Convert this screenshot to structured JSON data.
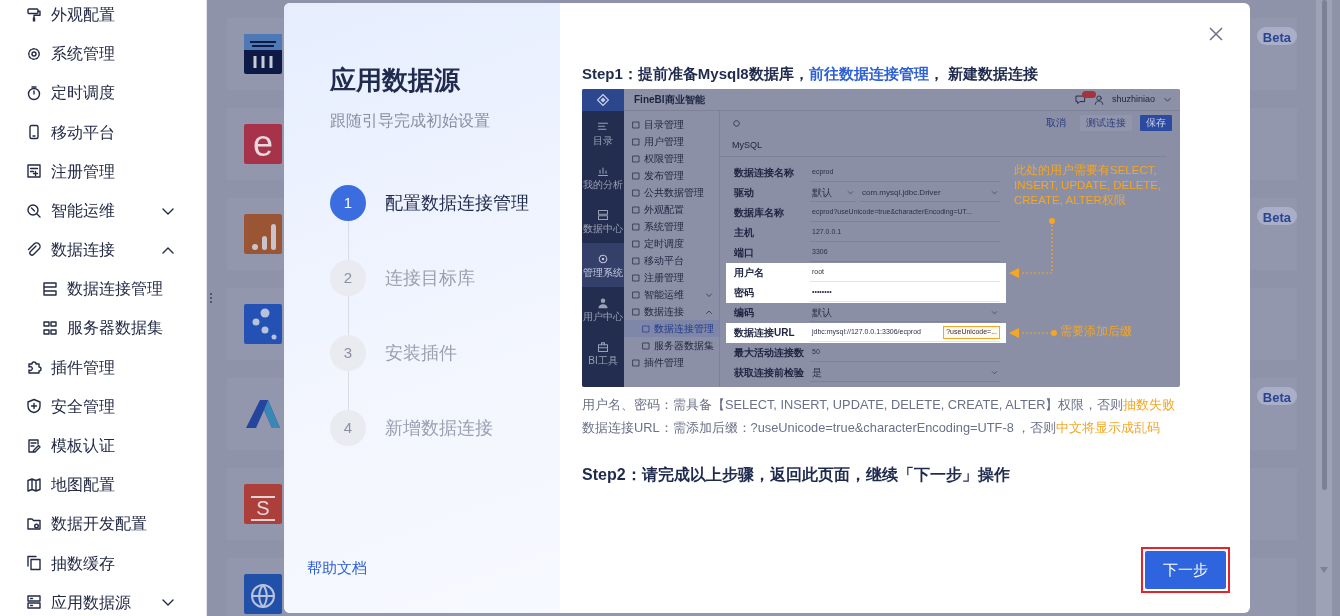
{
  "sidebar": {
    "items": [
      {
        "label": "外观配置"
      },
      {
        "label": "系统管理"
      },
      {
        "label": "定时调度"
      },
      {
        "label": "移动平台"
      },
      {
        "label": "注册管理"
      },
      {
        "label": "智能运维",
        "expanded": false
      },
      {
        "label": "数据连接",
        "expanded": true,
        "children": [
          {
            "label": "数据连接管理"
          },
          {
            "label": "服务器数据集"
          }
        ]
      },
      {
        "label": "插件管理"
      },
      {
        "label": "安全管理"
      },
      {
        "label": "模板认证"
      },
      {
        "label": "地图配置"
      },
      {
        "label": "数据开发配置"
      },
      {
        "label": "抽数缓存"
      },
      {
        "label": "应用数据源",
        "expanded": false
      }
    ]
  },
  "cards": [
    {
      "kind": "columns",
      "badge": "Beta"
    },
    {
      "kind": "letter",
      "logo_text": "e"
    },
    {
      "kind": "bars",
      "badge": "Beta"
    },
    {
      "kind": "dots"
    },
    {
      "kind": "chevron",
      "badge": "Beta"
    },
    {
      "kind": "bag",
      "logo_text": "S"
    },
    {
      "kind": "globe"
    }
  ],
  "modal": {
    "title": "应用数据源",
    "subtitle": "跟随引导完成初始设置",
    "steps": [
      {
        "number": "1",
        "label": "配置数据连接管理",
        "selected": true
      },
      {
        "number": "2",
        "label": "连接目标库",
        "selected": false
      },
      {
        "number": "3",
        "label": "安装插件",
        "selected": false
      },
      {
        "number": "4",
        "label": "新增数据连接",
        "selected": false
      }
    ],
    "help_link": "帮助文档",
    "step1": {
      "heading": [
        {
          "kind": "plain",
          "text": "Step1：提前准备Mysql8数据库，"
        },
        {
          "kind": "link",
          "text": "前往数据连接管理"
        },
        {
          "kind": "plain",
          "text": "， 新建数据连接"
        }
      ],
      "screenshot": {
        "brand": "FineBI商业智能",
        "user": "shuzhiniao",
        "rail": [
          {
            "label": "目录",
            "selected": false
          },
          {
            "label": "我的分析",
            "selected": false
          },
          {
            "label": "数据中心",
            "selected": false
          },
          {
            "label": "管理系统",
            "selected": true
          },
          {
            "label": "用户中心",
            "selected": false
          },
          {
            "label": "BI工具",
            "selected": false
          }
        ],
        "nav": [
          {
            "label": "目录管理",
            "selected": false
          },
          {
            "label": "用户管理",
            "selected": false
          },
          {
            "label": "权限管理",
            "selected": false
          },
          {
            "label": "发布管理",
            "selected": false
          },
          {
            "label": "公共数据管理",
            "selected": false
          },
          {
            "label": "外观配置",
            "selected": false
          },
          {
            "label": "系统管理",
            "selected": false
          },
          {
            "label": "定时调度",
            "selected": false
          },
          {
            "label": "移动平台",
            "selected": false
          },
          {
            "label": "注册管理",
            "selected": false
          },
          {
            "label": "智能运维",
            "selected": false,
            "expanded": false
          },
          {
            "label": "数据连接",
            "selected": false,
            "expanded": true,
            "children": [
              {
                "label": "数据连接管理",
                "selected": true
              },
              {
                "label": "服务器数据集",
                "selected": false
              }
            ]
          },
          {
            "label": "插件管理",
            "selected": false
          }
        ],
        "toolbar_buttons": [
          {
            "label": "取消",
            "kind": "text"
          },
          {
            "label": "测试连接",
            "kind": "secondary"
          },
          {
            "label": "保存",
            "kind": "primary"
          }
        ],
        "tab": "MySQL",
        "form": [
          {
            "label": "数据连接名称",
            "highlighted": false,
            "fields": [
              {
                "kind": "text",
                "value": "ecprod"
              }
            ]
          },
          {
            "label": "驱动",
            "highlighted": false,
            "fields": [
              {
                "kind": "select",
                "value": "默认"
              },
              {
                "kind": "select",
                "value": "com.mysql.jdbc.Driver"
              }
            ]
          },
          {
            "label": "数据库名称",
            "highlighted": false,
            "fields": [
              {
                "kind": "text",
                "value": "ecprod?useUnicode=true&characterEncoding=UT..."
              }
            ]
          },
          {
            "label": "主机",
            "highlighted": false,
            "fields": [
              {
                "kind": "text",
                "value": "127.0.0.1"
              }
            ]
          },
          {
            "label": "端口",
            "highlighted": false,
            "fields": [
              {
                "kind": "text",
                "value": "3306"
              }
            ]
          },
          {
            "label": "用户名",
            "highlighted": true,
            "fields": [
              {
                "kind": "text",
                "value": "root"
              }
            ]
          },
          {
            "label": "密码",
            "highlighted": true,
            "fields": [
              {
                "kind": "text",
                "value": "••••••••"
              }
            ]
          },
          {
            "label": "编码",
            "highlighted": false,
            "fields": [
              {
                "kind": "select",
                "value": "默认"
              }
            ]
          },
          {
            "label": "数据连接URL",
            "highlighted": true,
            "fields": [
              {
                "kind": "text",
                "value": "jdbc:mysql://127.0.0.1:3306/ecprod",
                "suffix": "?useUnicode=..."
              }
            ]
          },
          {
            "label": "最大活动连接数",
            "highlighted": false,
            "fields": [
              {
                "kind": "text",
                "value": "50"
              }
            ]
          },
          {
            "label": "获取连接前检验",
            "highlighted": false,
            "fields": [
              {
                "kind": "select",
                "value": "是"
              }
            ]
          }
        ],
        "annotations": [
          {
            "text": "此处的用户需要有SELECT, INSERT, UPDATE, DELETE, CREATE, ALTER权限"
          },
          {
            "text": "需要添加后缀"
          }
        ]
      },
      "notes": [
        [
          {
            "kind": "plain",
            "text": "用户名、密码：需具备【SELECT, INSERT, UPDATE, DELETE, CREATE, ALTER】权限，否则"
          },
          {
            "kind": "warn",
            "text": "抽数失败"
          }
        ],
        [
          {
            "kind": "plain",
            "text": "数据连接URL：需添加后缀：?useUnicode=true&characterEncoding=UTF-8 ，否则"
          },
          {
            "kind": "warn",
            "text": "中文将显示成乱码"
          }
        ]
      ]
    },
    "step2": "Step2：请完成以上步骤，返回此页面，继续「下一步」操作",
    "next_button": {
      "label": "下一步",
      "highlighted": true
    }
  }
}
